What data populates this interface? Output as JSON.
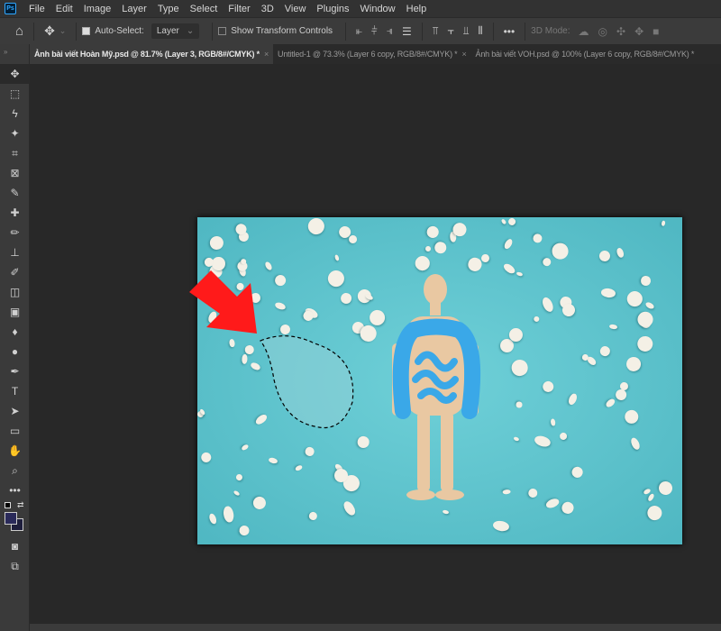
{
  "menubar": {
    "logo": "Ps",
    "items": [
      "File",
      "Edit",
      "Image",
      "Layer",
      "Type",
      "Select",
      "Filter",
      "3D",
      "View",
      "Plugins",
      "Window",
      "Help"
    ]
  },
  "options": {
    "auto_select_label": "Auto-Select:",
    "auto_select_checked": true,
    "target_value": "Layer",
    "show_transform_label": "Show Transform Controls",
    "show_transform_checked": false,
    "more": "•••",
    "mode_3d_label": "3D Mode:"
  },
  "tabs": [
    {
      "label": "Ảnh bài viết Hoàn Mỹ.psd @ 81.7% (Layer 3, RGB/8#/CMYK) *",
      "active": true
    },
    {
      "label": "Untitled-1 @ 73.3% (Layer 6 copy, RGB/8#/CMYK) *",
      "active": false
    },
    {
      "label": "Ảnh bài viết VOH.psd @ 100% (Layer 6 copy, RGB/8#/CMYK) *",
      "active": false
    }
  ],
  "tools": [
    "move-tool",
    "marquee-tool",
    "lasso-tool",
    "magic-wand-tool",
    "crop-tool",
    "frame-tool",
    "eyedropper-tool",
    "healing-brush-tool",
    "brush-tool",
    "clone-stamp-tool",
    "history-brush-tool",
    "eraser-tool",
    "gradient-tool",
    "blur-tool",
    "dodge-tool",
    "pen-tool",
    "type-tool",
    "path-selection-tool",
    "rectangle-tool",
    "hand-tool",
    "zoom-tool",
    "more-tools"
  ],
  "colors": {
    "foreground": "#2a2a5a",
    "background": "#1e1e3c",
    "canvas_bg": "#58bec8",
    "arrow": "#ff1a1a"
  }
}
